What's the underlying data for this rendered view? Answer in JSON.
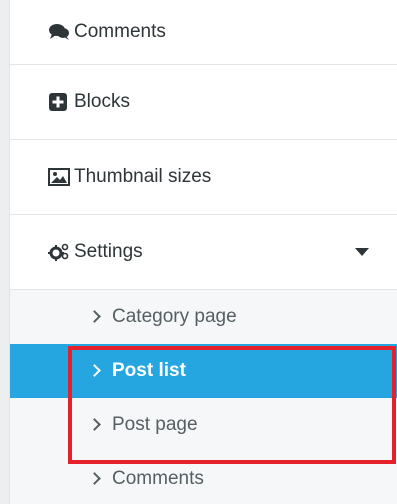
{
  "menu": {
    "items": [
      {
        "label": "Comments",
        "icon": "comments-icon"
      },
      {
        "label": "Blocks",
        "icon": "plus-square-icon"
      },
      {
        "label": "Thumbnail sizes",
        "icon": "image-icon"
      },
      {
        "label": "Settings",
        "icon": "cogs-icon",
        "expanded": true
      }
    ],
    "submenu": [
      {
        "label": "Category page"
      },
      {
        "label": "Post list",
        "active": true
      },
      {
        "label": "Post page"
      },
      {
        "label": "Comments"
      }
    ]
  },
  "colors": {
    "active_bg": "#25a6e0",
    "highlight_border": "#e3222c",
    "text": "#2e3538"
  }
}
